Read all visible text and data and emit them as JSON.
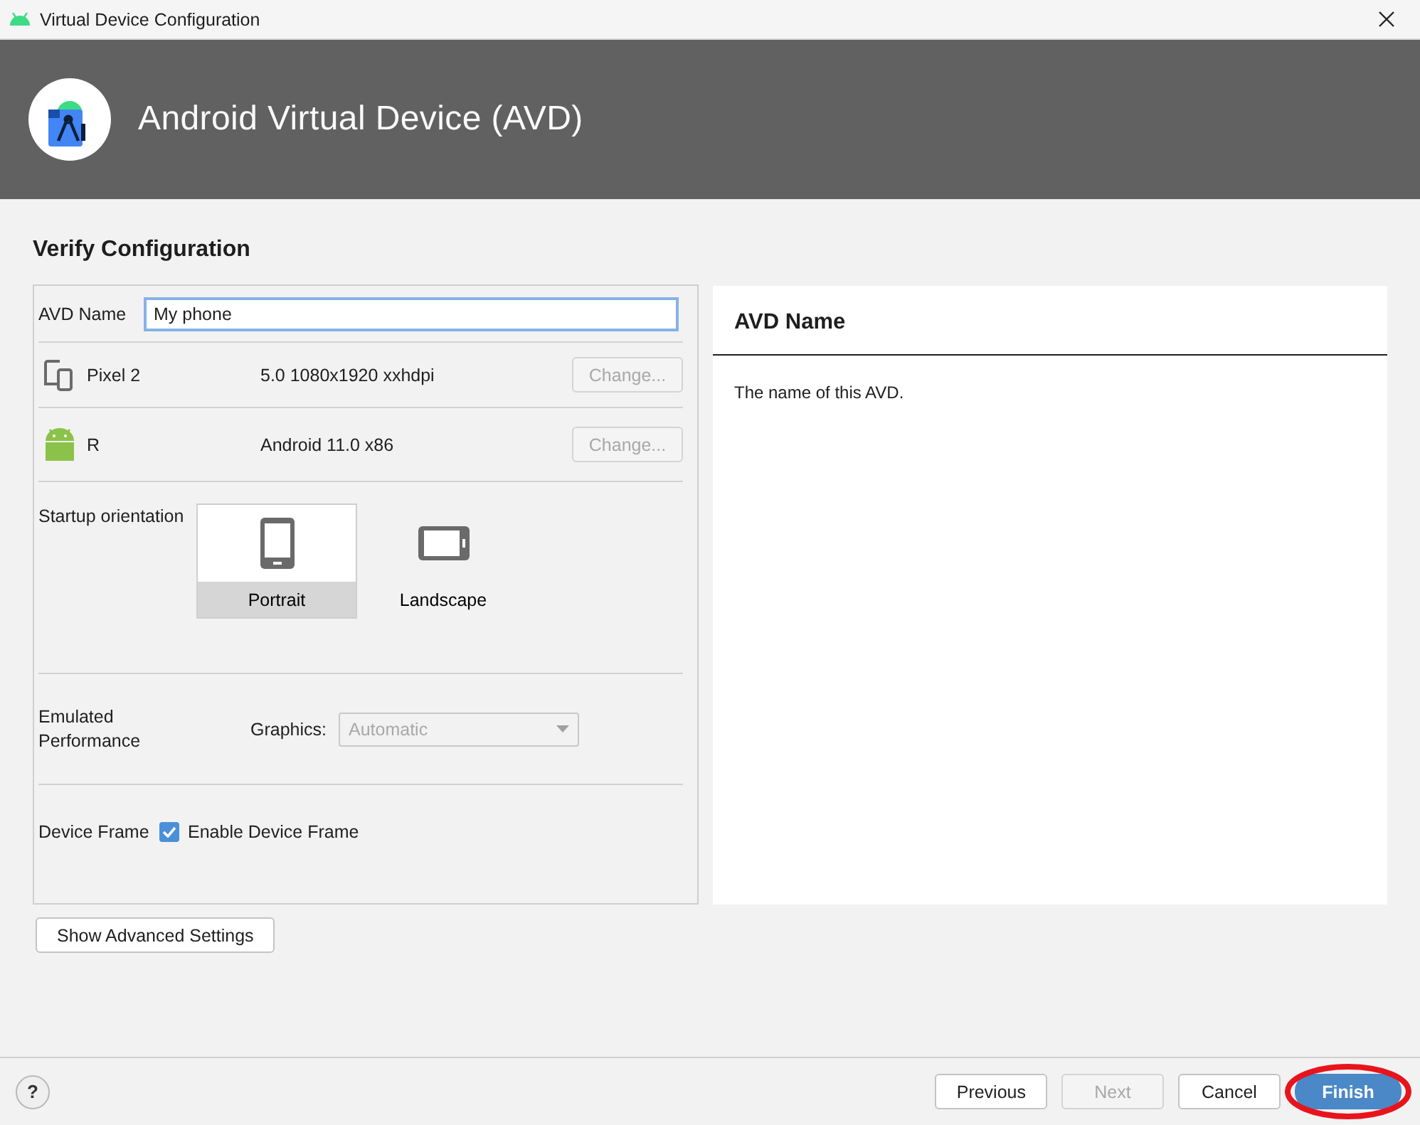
{
  "window": {
    "title": "Virtual Device Configuration"
  },
  "header": {
    "title": "Android Virtual Device (AVD)"
  },
  "section_title": "Verify Configuration",
  "avd_name": {
    "label": "AVD Name",
    "value": "My phone"
  },
  "hardware": {
    "name": "Pixel 2",
    "spec": "5.0 1080x1920 xxhdpi",
    "button": {
      "label": "Change...",
      "disabled": true
    }
  },
  "system_image": {
    "name": "R",
    "spec": "Android 11.0 x86",
    "button": {
      "label": "Change...",
      "disabled": true
    }
  },
  "orientation": {
    "label": "Startup orientation",
    "options": [
      {
        "kind": "portrait",
        "label": "Portrait",
        "selected": true
      },
      {
        "kind": "landscape",
        "label": "Landscape",
        "selected": false
      }
    ]
  },
  "performance": {
    "label": "Emulated Performance",
    "graphics_label": "Graphics:",
    "graphics_value": "Automatic",
    "disabled": true
  },
  "device_frame": {
    "label": "Device Frame",
    "checkbox": {
      "label": "Enable Device Frame",
      "checked": true
    }
  },
  "advanced_button": "Show Advanced Settings",
  "help_panel": {
    "title": "AVD Name",
    "text": "The name of this AVD."
  },
  "footer": {
    "help": "?",
    "buttons": [
      {
        "label": "Previous",
        "disabled": false,
        "primary": false,
        "highlighted": false
      },
      {
        "label": "Next",
        "disabled": true,
        "primary": false,
        "highlighted": false
      },
      {
        "label": "Cancel",
        "disabled": false,
        "primary": false,
        "highlighted": false
      },
      {
        "label": "Finish",
        "disabled": false,
        "primary": true,
        "highlighted": true
      }
    ]
  }
}
